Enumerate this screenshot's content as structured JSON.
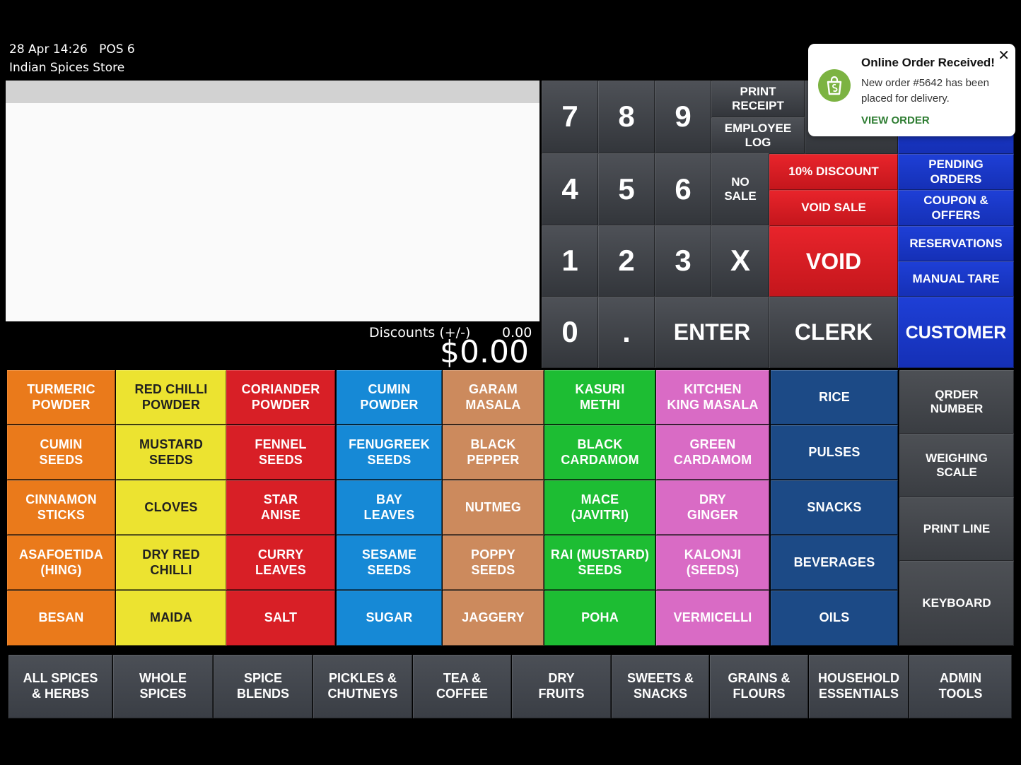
{
  "header": {
    "datetime": "28 Apr 14:26",
    "pos": "POS 6",
    "store": "Indian Spices Store"
  },
  "summary": {
    "discounts_label": "Discounts (+/-)",
    "discounts_value": "0.00",
    "total": "$0.00"
  },
  "keypad": {
    "k7": "7",
    "k8": "8",
    "k9": "9",
    "k4": "4",
    "k5": "5",
    "k6": "6",
    "k1": "1",
    "k2": "2",
    "k3": "3",
    "k0": "0",
    "dot": ".",
    "x": "X",
    "enter": "ENTER"
  },
  "functions": {
    "print_receipt": "PRINT\nRECEIPT",
    "employee_log": "EMPLOYEE\nLOG",
    "no_sale": "NO\nSALE",
    "discount10": "10% DISCOUNT",
    "void_sale": "VOID SALE",
    "void": "VOID",
    "clerk": "CLERK",
    "pending_orders": "PENDING\nORDERS",
    "coupon_offers": "COUPON &\nOFFERS",
    "reservations": "RESERVATIONS",
    "manual_tare": "MANUAL TARE",
    "customer": "CUSTOMER"
  },
  "items": [
    [
      "TURMERIC\nPOWDER",
      "RED CHILLI\nPOWDER",
      "CORIANDER\nPOWDER",
      "CUMIN\nPOWDER",
      "GARAM\nMASALA",
      "KASURI\nMETHI",
      "KITCHEN\nKING MASALA",
      "RICE"
    ],
    [
      "CUMIN\nSEEDS",
      "MUSTARD\nSEEDS",
      "FENNEL\nSEEDS",
      "FENUGREEK\nSEEDS",
      "BLACK\nPEPPER",
      "BLACK\nCARDAMOM",
      "GREEN\nCARDAMOM",
      "PULSES"
    ],
    [
      "CINNAMON\nSTICKS",
      "CLOVES",
      "STAR\nANISE",
      "BAY\nLEAVES",
      "NUTMEG",
      "MACE\n(JAVITRI)",
      "DRY\nGINGER",
      "SNACKS"
    ],
    [
      "ASAFOETIDA\n(HING)",
      "DRY RED\nCHILLI",
      "CURRY\nLEAVES",
      "SESAME\nSEEDS",
      "POPPY\nSEEDS",
      "RAI (MUSTARD)\nSEEDS",
      "KALONJI\n(SEEDS)",
      "BEVERAGES"
    ],
    [
      "BESAN",
      "MAIDA",
      "SALT",
      "SUGAR",
      "JAGGERY",
      "POHA",
      "VERMICELLI",
      "OILS"
    ]
  ],
  "right_tools": {
    "order_number": "QRDER\nNUMBER",
    "weighing_scale": "WEIGHING\nSCALE",
    "print_line": "PRINT LINE",
    "keyboard": "KEYBOARD"
  },
  "categories": [
    "ALL SPICES\n& HERBS",
    "WHOLE\nSPICES",
    "SPICE\nBLENDS",
    "PICKLES &\nCHUTNEYS",
    "TEA &\nCOFFEE",
    "DRY\nFRUITS",
    "SWEETS &\nSNACKS",
    "GRAINS &\nFLOURS",
    "HOUSEHOLD\nESSENTIALS",
    "ADMIN\nTOOLS"
  ],
  "toast": {
    "title": "Online Order Received!",
    "message": "New order #5642 has been placed for delivery.",
    "link": "VIEW ORDER",
    "close": "✕",
    "icon": "shopping-bag-icon"
  }
}
